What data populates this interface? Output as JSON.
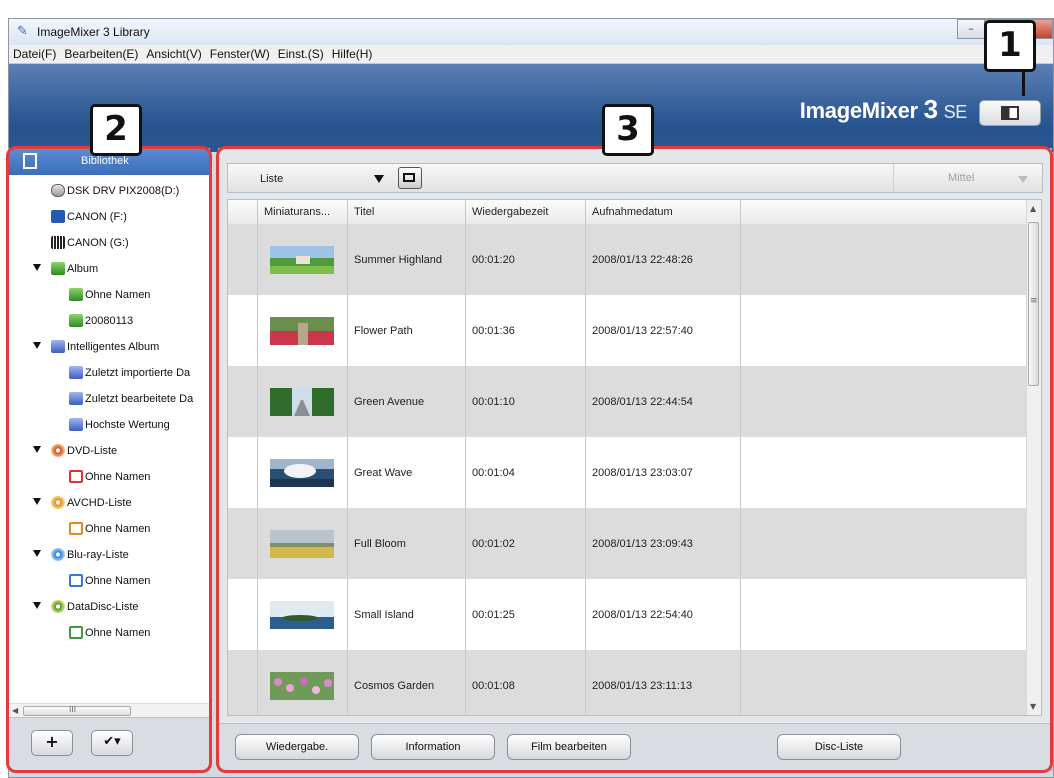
{
  "window": {
    "title": "ImageMixer 3 Library",
    "buttons": {
      "minimize": "–",
      "maximize": "□",
      "close": "X"
    }
  },
  "menu": [
    "Datei(F)",
    "Bearbeiten(E)",
    "Ansicht(V)",
    "Fenster(W)",
    "Einst.(S)",
    "Hilfe(H)"
  ],
  "banner": {
    "brand": "ImageMixer",
    "version": "3",
    "edition": "SE"
  },
  "callouts": {
    "c1": "1",
    "c2": "2",
    "c3": "3"
  },
  "sidebar": {
    "header": "Bibliothek",
    "items": [
      {
        "label": "DSK DRV PIX2008(D:)",
        "icon": "drive-icon"
      },
      {
        "label": "CANON (F:)",
        "icon": "card-icon"
      },
      {
        "label": "CANON (G:)",
        "icon": "memory-icon"
      },
      {
        "label": "Album",
        "icon": "album-icon"
      },
      {
        "label": "Ohne Namen",
        "icon": "album-icon"
      },
      {
        "label": "20080113",
        "icon": "album-icon"
      },
      {
        "label": "Intelligentes Album",
        "icon": "smart-album-icon"
      },
      {
        "label": "Zuletzt importierte Da",
        "icon": "smart-album-icon"
      },
      {
        "label": "Zuletzt bearbeitete Da",
        "icon": "smart-album-icon"
      },
      {
        "label": "Hochste Wertung",
        "icon": "smart-album-icon"
      },
      {
        "label": "DVD-Liste",
        "icon": "dvd-disc-icon"
      },
      {
        "label": "Ohne Namen",
        "icon": "dvd-item-icon"
      },
      {
        "label": "AVCHD-Liste",
        "icon": "avchd-disc-icon"
      },
      {
        "label": "Ohne Namen",
        "icon": "avchd-item-icon"
      },
      {
        "label": "Blu-ray-Liste",
        "icon": "bluray-disc-icon"
      },
      {
        "label": "Ohne Namen",
        "icon": "bluray-item-icon"
      },
      {
        "label": "DataDisc-Liste",
        "icon": "datadisc-icon"
      },
      {
        "label": "Ohne Namen",
        "icon": "datadisc-item-icon"
      }
    ],
    "hscroll_grip": "III",
    "add_label": "+",
    "tools_label": "✔▾"
  },
  "toolbar": {
    "view": "Liste",
    "size": "Mittel"
  },
  "table": {
    "columns": [
      "Miniaturans...",
      "Titel",
      "Wiedergabezeit",
      "Aufnahmedatum"
    ],
    "rows": [
      {
        "title": "Summer Highland",
        "duration": "00:01:20",
        "date": "2008/01/13 22:48:26",
        "thumb": "highland"
      },
      {
        "title": "Flower Path",
        "duration": "00:01:36",
        "date": "2008/01/13 22:57:40",
        "thumb": "flowerpath"
      },
      {
        "title": "Green Avenue",
        "duration": "00:01:10",
        "date": "2008/01/13 22:44:54",
        "thumb": "avenue"
      },
      {
        "title": "Great Wave",
        "duration": "00:01:04",
        "date": "2008/01/13 23:03:07",
        "thumb": "wave"
      },
      {
        "title": "Full Bloom",
        "duration": "00:01:02",
        "date": "2008/01/13 23:09:43",
        "thumb": "bloom"
      },
      {
        "title": "Small Island",
        "duration": "00:01:25",
        "date": "2008/01/13 22:54:40",
        "thumb": "island"
      },
      {
        "title": "Cosmos Garden",
        "duration": "00:01:08",
        "date": "2008/01/13 23:11:13",
        "thumb": "cosmos"
      }
    ]
  },
  "actions": {
    "play": "Wiedergabe.",
    "info": "Information",
    "edit": "Film bearbeiten",
    "disc": "Disc-Liste"
  },
  "colors": {
    "accent_blue": "#3b6dba",
    "callout_red": "#e23b3b",
    "banner_blue": "#27538f"
  }
}
